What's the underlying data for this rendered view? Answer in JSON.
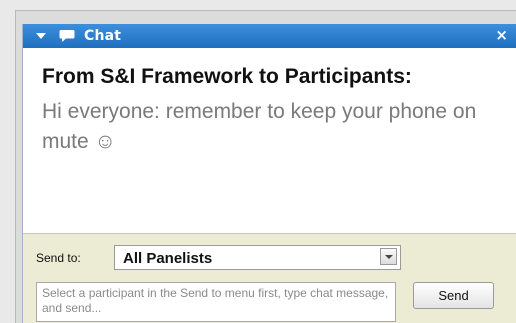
{
  "window": {
    "title": "Chat",
    "close_glyph": "×",
    "titlebar_color": "#2b7fd0"
  },
  "message": {
    "sender": "From S&I Framework to Participants:",
    "text": "Hi everyone: remember to keep your phone on mute ☺"
  },
  "compose": {
    "send_to_label": "Send to:",
    "send_to_value": "All Panelists",
    "input_placeholder": "Select a participant in the Send to menu first, type chat message, and send...",
    "send_label": "Send",
    "background_color": "#ecebd4"
  },
  "icons": {
    "collapse": "triangle-down-icon",
    "chat": "chat-bubble-icon",
    "close": "close-icon",
    "dropdown": "chevron-down-icon"
  }
}
